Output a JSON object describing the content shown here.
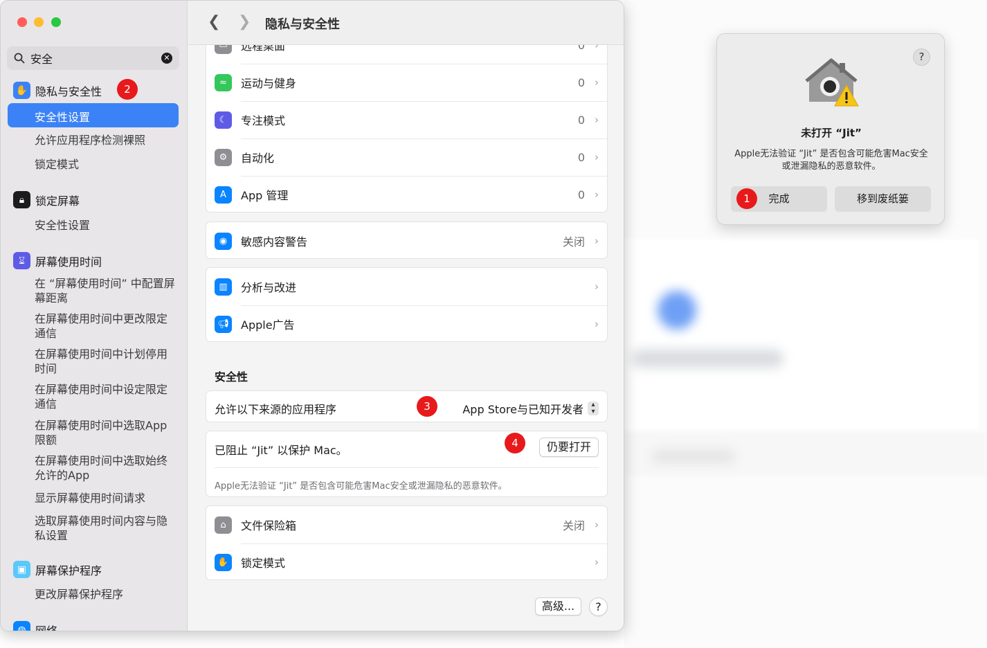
{
  "sidebar": {
    "search_value": "安全",
    "privacy": {
      "title": "隐私与安全性",
      "items": [
        "安全性设置",
        "允许应用程序检测裸照",
        "锁定模式"
      ]
    },
    "lock_screen": {
      "title": "锁定屏幕",
      "items": [
        "安全性设置"
      ]
    },
    "screen_time": {
      "title": "屏幕使用时间",
      "items": [
        "在 “屏幕使用时间” 中配置屏幕距离",
        "在屏幕使用时间中更改限定通信",
        "在屏幕使用时间中计划停用时间",
        "在屏幕使用时间中设定限定通信",
        "在屏幕使用时间中选取App限额",
        "在屏幕使用时间中选取始终允许的App",
        "显示屏幕使用时间请求",
        "选取屏幕使用时间内容与隐私设置"
      ]
    },
    "screensaver": {
      "title": "屏幕保护程序",
      "items": [
        "更改屏幕保护程序"
      ]
    },
    "network": {
      "title": "网络"
    }
  },
  "toolbar": {
    "title": "隐私与安全性"
  },
  "list1": [
    {
      "label": "远程桌面",
      "value": "0"
    },
    {
      "label": "运动与健身",
      "value": "0",
      "icon": "fitness-icon",
      "color": "#34c759"
    },
    {
      "label": "专注模式",
      "value": "0",
      "icon": "moon-icon",
      "color": "#5e5ce6"
    },
    {
      "label": "自动化",
      "value": "0",
      "icon": "gears-icon",
      "color": "#8e8e93"
    },
    {
      "label": "App 管理",
      "value": "0",
      "icon": "app-store-icon",
      "color": "#0a84ff"
    }
  ],
  "sensitive": {
    "label": "敏感内容警告",
    "value": "关闭"
  },
  "analytics": [
    {
      "label": "分析与改进"
    },
    {
      "label": "Apple广告"
    }
  ],
  "security": {
    "title": "安全性",
    "allow_label": "允许以下来源的应用程序",
    "allow_value": "App Store与已知开发者",
    "blocked_label": "已阻止 “Jit” 以保护 Mac。",
    "open_anyway": "仍要打开",
    "note": "Apple无法验证 “Jit” 是否包含可能危害Mac安全或泄漏隐私的恶意软件。"
  },
  "bottom": [
    {
      "label": "文件保险箱",
      "value": "关闭"
    },
    {
      "label": "锁定模式"
    }
  ],
  "advanced_button": "高级...",
  "help_glyph": "?",
  "dialog": {
    "title": "未打开 “Jit”",
    "text": "Apple无法验证 “Jit” 是否包含可能危害Mac安全或泄漏隐私的恶意软件。",
    "done": "完成",
    "trash": "移到废纸篓"
  },
  "badges": [
    "1",
    "2",
    "3",
    "4"
  ],
  "colors": {
    "accent": "#3b82f6",
    "badge": "#e8191b"
  }
}
